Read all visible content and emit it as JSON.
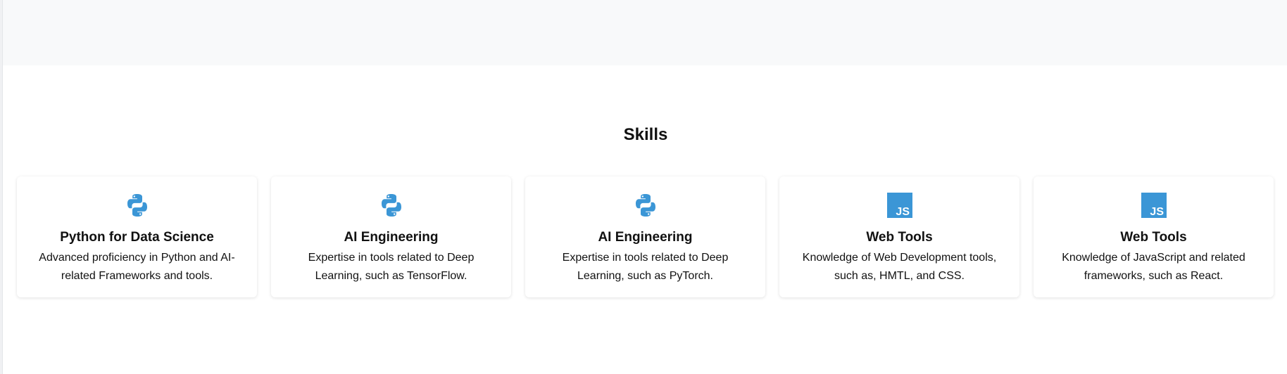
{
  "colors": {
    "icon": "#3b96d6",
    "top_band": "#f8f9fa",
    "text": "#111111"
  },
  "skills": {
    "title": "Skills",
    "cards": [
      {
        "icon": "python-icon",
        "title": "Python for Data Science",
        "description": "Advanced proficiency in Python and AI-related Frameworks and tools."
      },
      {
        "icon": "python-icon",
        "title": "AI Engineering",
        "description": "Expertise in tools related to Deep Learning, such as TensorFlow."
      },
      {
        "icon": "python-icon",
        "title": "AI Engineering",
        "description": "Expertise in tools related to Deep Learning, such as PyTorch."
      },
      {
        "icon": "javascript-icon",
        "title": "Web Tools",
        "description": "Knowledge of Web Development tools, such as, HMTL, and CSS."
      },
      {
        "icon": "javascript-icon",
        "title": "Web Tools",
        "description": "Knowledge of JavaScript and related frameworks, such as React."
      }
    ]
  }
}
